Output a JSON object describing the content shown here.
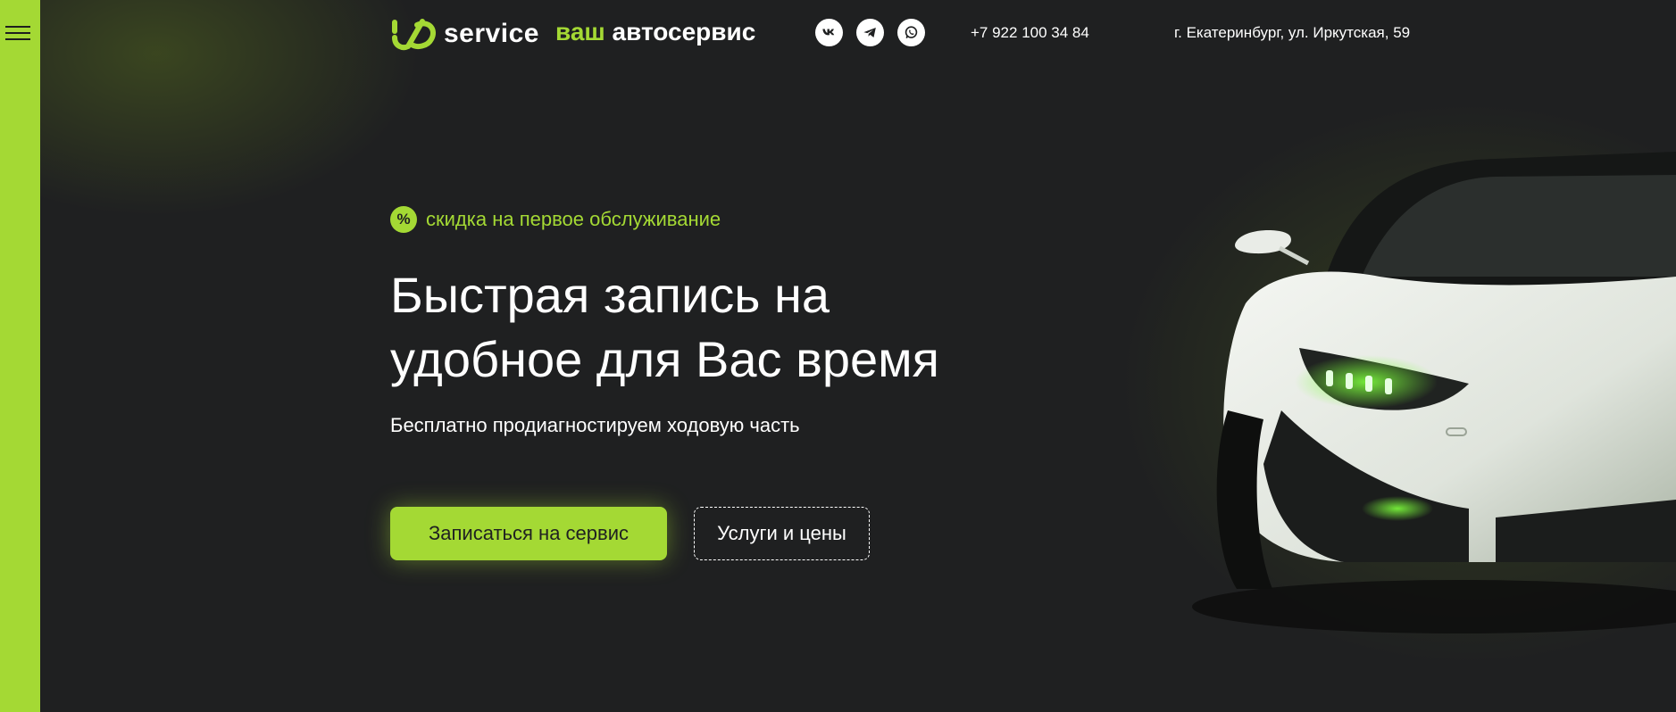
{
  "menu": {
    "icon": "hamburger-menu-icon"
  },
  "header": {
    "logo": {
      "icon": "brand-logo-mark",
      "service": "service"
    },
    "tagline": {
      "accent": "ваш",
      "rest": "автосервис"
    },
    "socials": [
      {
        "name": "vk-icon"
      },
      {
        "name": "telegram-icon"
      },
      {
        "name": "whatsapp-icon"
      }
    ],
    "phone": "+7 922 100 34 84",
    "address": "г. Екатеринбург, ул. Иркутская, 59"
  },
  "hero": {
    "promo_icon": "%",
    "promo": "скидка на первое обслуживание",
    "title_line1": "Быстрая запись на",
    "title_line2": "удобное для Вас время",
    "subtitle": "Бесплатно продиагностируем ходовую часть",
    "primary_button": "Записаться на сервис",
    "secondary_button": "Услуги и цены",
    "image": "white-sports-car-image"
  },
  "colors": {
    "accent": "#a4d934",
    "background": "#1f2021",
    "text": "#ffffff"
  }
}
